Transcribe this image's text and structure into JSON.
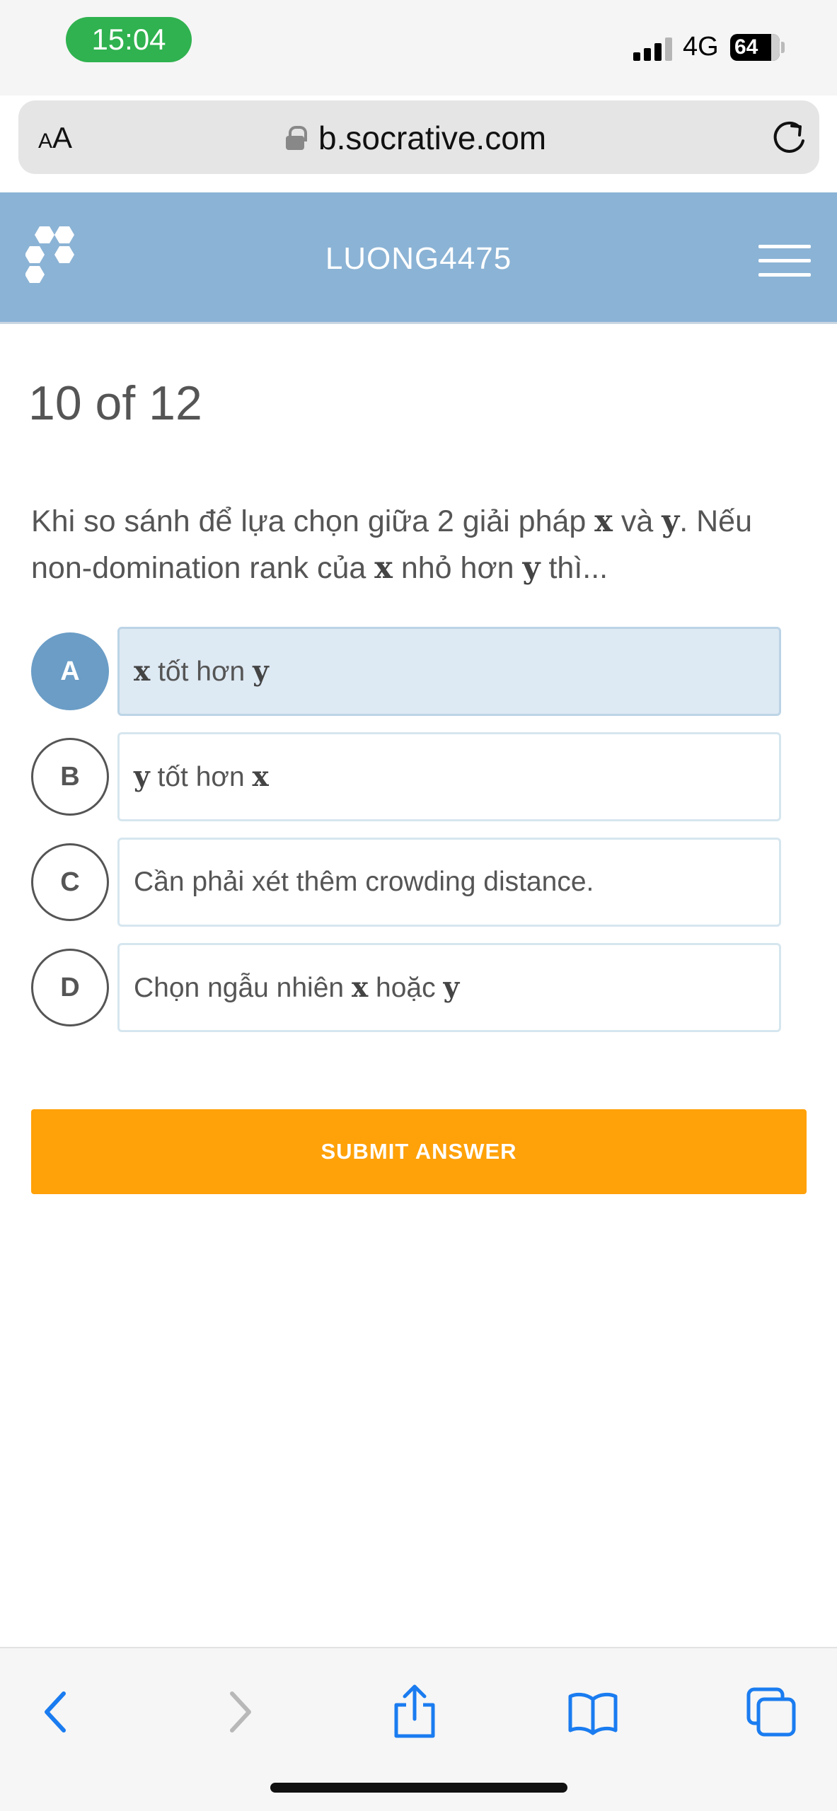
{
  "status": {
    "time": "15:04",
    "network": "4G",
    "battery": "64"
  },
  "browser": {
    "text_size_label": "AA",
    "domain": "b.socrative.com"
  },
  "header": {
    "room_name": "LUONG4475"
  },
  "quiz": {
    "progress": "10 of 12",
    "question_prefix": "Khi so sánh để lựa chọn giữa 2 giải pháp ",
    "question_var_x": "x",
    "question_and": " và ",
    "question_var_y": "y",
    "question_mid": ". Nếu non-domination rank của ",
    "question_var_x2": "x",
    "question_less": " nhỏ hơn ",
    "question_var_y2": "y",
    "question_suffix": " thì...",
    "options": [
      {
        "letter": "A",
        "var1": "x",
        "text": " tốt hơn ",
        "var2": "y",
        "selected": true
      },
      {
        "letter": "B",
        "var1": "y",
        "text": " tốt hơn ",
        "var2": "x",
        "selected": false
      },
      {
        "letter": "C",
        "text": "Cần phải xét thêm crowding distance.",
        "selected": false
      },
      {
        "letter": "D",
        "prefix": "Chọn ngẫu nhiên ",
        "var1": "x",
        "text": " hoặc ",
        "var2": "y",
        "selected": false
      }
    ],
    "submit_label": "SUBMIT ANSWER"
  },
  "colors": {
    "header": "#8bb3d5",
    "selected": "#6b9dc6",
    "submit": "#ffa109",
    "toolbar_icon": "#1a7cf0"
  },
  "icons": [
    "lock-icon",
    "reload-icon",
    "socrative-logo",
    "hamburger-menu-icon",
    "back-icon",
    "forward-icon",
    "share-icon",
    "bookmarks-icon",
    "tabs-icon"
  ]
}
